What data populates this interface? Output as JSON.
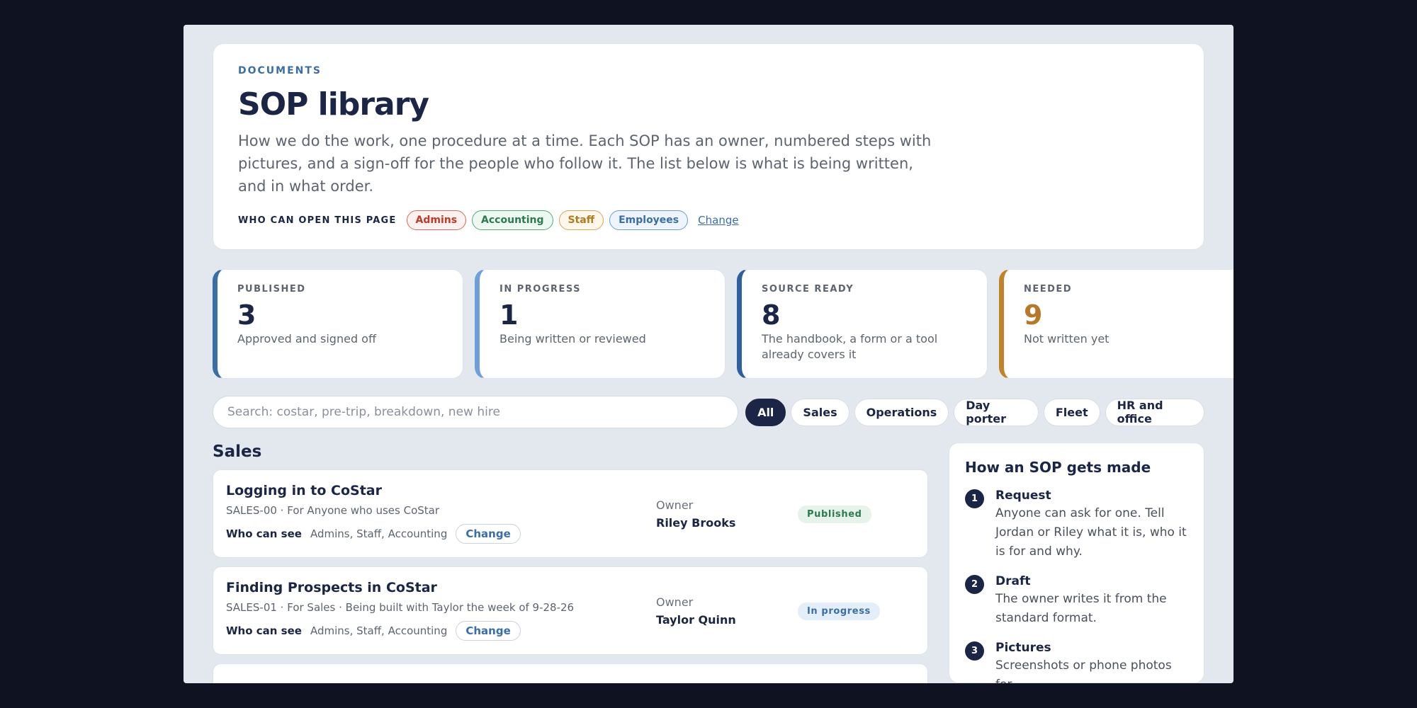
{
  "hero": {
    "eyebrow": "DOCUMENTS",
    "title": "SOP library",
    "description": "How we do the work, one procedure at a time. Each SOP has an owner, numbered steps with pictures, and a sign-off for the people who follow it. The list below is what is being written, and in what order.",
    "access_label": "WHO CAN OPEN THIS PAGE",
    "access_pills": [
      "Admins",
      "Accounting",
      "Staff",
      "Employees"
    ],
    "change_label": "Change"
  },
  "stats": [
    {
      "label": "PUBLISHED",
      "value": "3",
      "desc": "Approved and signed off"
    },
    {
      "label": "IN PROGRESS",
      "value": "1",
      "desc": "Being written or reviewed"
    },
    {
      "label": "SOURCE READY",
      "value": "8",
      "desc": "The handbook, a form or a tool already covers it"
    },
    {
      "label": "NEEDED",
      "value": "9",
      "desc": "Not written yet"
    }
  ],
  "search": {
    "placeholder": "Search: costar, pre-trip, breakdown, new hire"
  },
  "filters": [
    "All",
    "Sales",
    "Operations",
    "Day porter",
    "Fleet",
    "HR and office"
  ],
  "section": {
    "title": "Sales"
  },
  "sops": [
    {
      "title": "Logging in to CoStar",
      "meta": "SALES-00 · For Anyone who uses CoStar",
      "access_label": "Who can see",
      "access_value": "Admins, Staff, Accounting",
      "change_label": "Change",
      "owner_label": "Owner",
      "owner_name": "Riley Brooks",
      "status": "Published"
    },
    {
      "title": "Finding Prospects in CoStar",
      "meta": "SALES-01 · For Sales · Being built with Taylor the week of 9-28-26",
      "access_label": "Who can see",
      "access_value": "Admins, Staff, Accounting",
      "change_label": "Change",
      "owner_label": "Owner",
      "owner_name": "Taylor Quinn",
      "status": "In progress"
    }
  ],
  "panel": {
    "title": "How an SOP gets made",
    "steps": [
      {
        "num": "1",
        "title": "Request",
        "desc": "Anyone can ask for one. Tell Jordan or Riley what it is, who it is for and why."
      },
      {
        "num": "2",
        "title": "Draft",
        "desc": "The owner writes it from the standard format."
      },
      {
        "num": "3",
        "title": "Pictures",
        "desc": "Screenshots or phone photos for"
      }
    ]
  }
}
